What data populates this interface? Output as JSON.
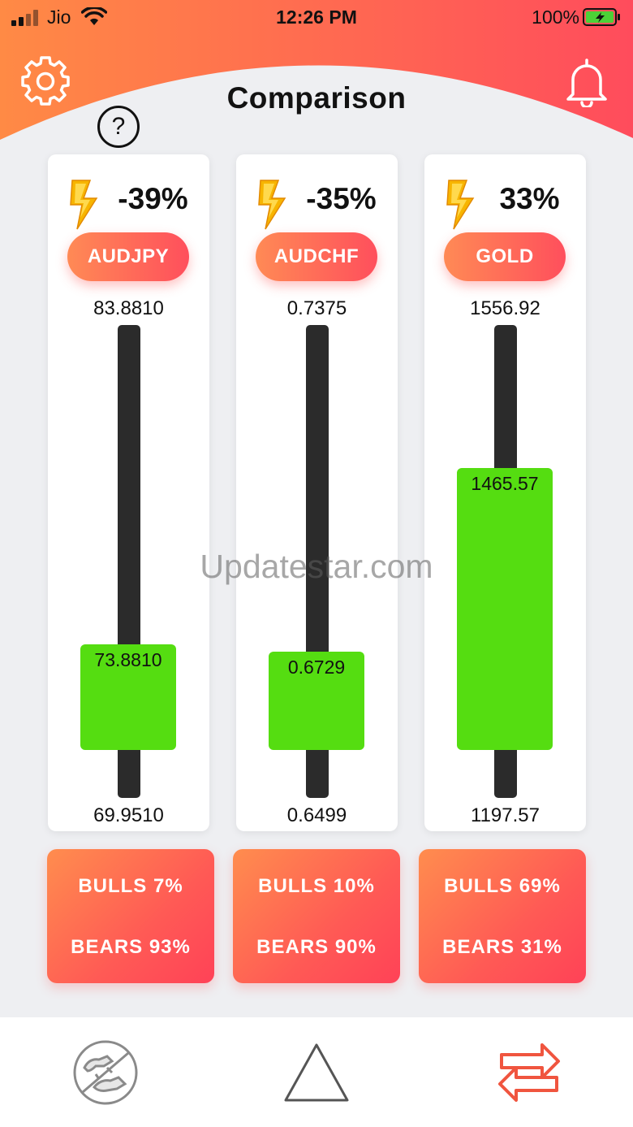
{
  "status_bar": {
    "carrier": "Jio",
    "time": "12:26 PM",
    "battery": "100%"
  },
  "header": {
    "title": "Comparison",
    "help_label": "?"
  },
  "cards": [
    {
      "change": "-39%",
      "symbol": "AUDJPY",
      "high": "83.8810",
      "current": "73.8810",
      "low": "69.9510",
      "bulls": "BULLS  7%",
      "bears": "BEARS  93%"
    },
    {
      "change": "-35%",
      "symbol": "AUDCHF",
      "high": "0.7375",
      "current": "0.6729",
      "low": "0.6499",
      "bulls": "BULLS  10%",
      "bears": "BEARS  90%"
    },
    {
      "change": "33%",
      "symbol": "GOLD",
      "high": "1556.92",
      "current": "1465.57",
      "low": "1197.57",
      "bulls": "BULLS  69%",
      "bears": "BEARS  31%"
    }
  ],
  "watermark": "Updatestar.com",
  "tabs": [
    {
      "icon": "bull-bear-icon"
    },
    {
      "icon": "triangle-icon"
    },
    {
      "icon": "swap-arrows-icon"
    }
  ],
  "colors": {
    "header_gradient_start": "#ff8a45",
    "header_gradient_end": "#ff4c5c",
    "bar_green": "#55dd11",
    "track_dark": "#2b2b2b",
    "swap_active": "#f0553f"
  }
}
